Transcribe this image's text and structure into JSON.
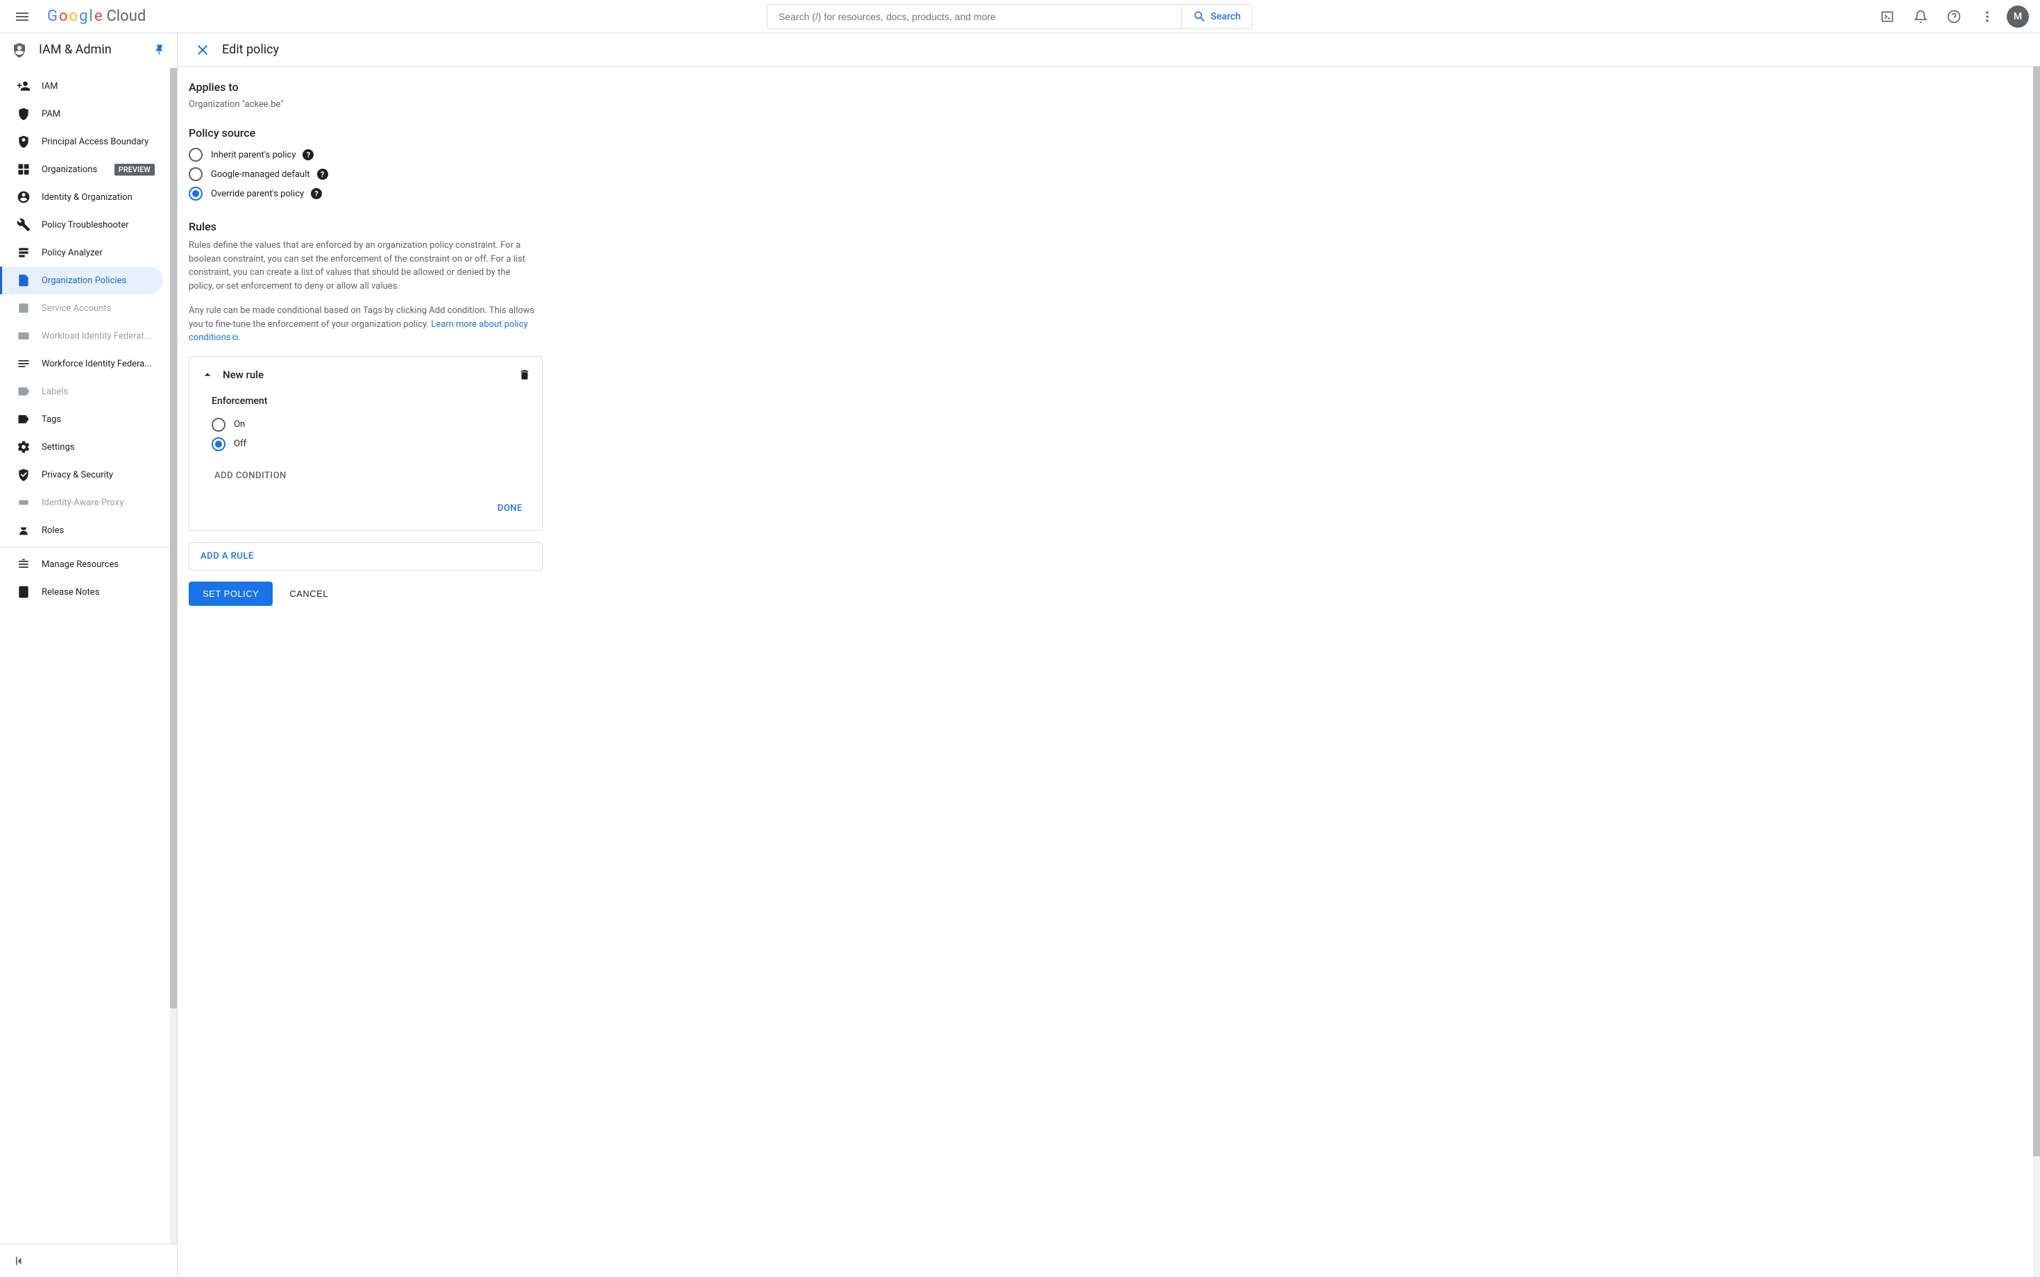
{
  "header": {
    "search_placeholder": "Search (/) for resources, docs, products, and more",
    "search_button": "Search",
    "avatar_letter": "M"
  },
  "sidebar": {
    "title": "IAM & Admin",
    "items": [
      {
        "label": "IAM",
        "icon": "person-add",
        "active": false,
        "disabled": false
      },
      {
        "label": "PAM",
        "icon": "shield",
        "active": false,
        "disabled": false
      },
      {
        "label": "Principal Access Boundary",
        "icon": "boundary",
        "active": false,
        "disabled": false
      },
      {
        "label": "Organizations",
        "icon": "org",
        "active": false,
        "disabled": false,
        "badge": "PREVIEW"
      },
      {
        "label": "Identity & Organization",
        "icon": "account",
        "active": false,
        "disabled": false
      },
      {
        "label": "Policy Troubleshooter",
        "icon": "wrench",
        "active": false,
        "disabled": false
      },
      {
        "label": "Policy Analyzer",
        "icon": "analyzer",
        "active": false,
        "disabled": false
      },
      {
        "label": "Organization Policies",
        "icon": "doc",
        "active": true,
        "disabled": false
      },
      {
        "label": "Service Accounts",
        "icon": "service",
        "active": false,
        "disabled": true
      },
      {
        "label": "Workload Identity Federat...",
        "icon": "workload",
        "active": false,
        "disabled": true
      },
      {
        "label": "Workforce Identity Federa...",
        "icon": "workforce",
        "active": false,
        "disabled": false
      },
      {
        "label": "Labels",
        "icon": "label",
        "active": false,
        "disabled": true
      },
      {
        "label": "Tags",
        "icon": "tag",
        "active": false,
        "disabled": false
      },
      {
        "label": "Settings",
        "icon": "gear",
        "active": false,
        "disabled": false
      },
      {
        "label": "Privacy & Security",
        "icon": "privacy",
        "active": false,
        "disabled": false
      },
      {
        "label": "Identity-Aware Proxy",
        "icon": "proxy",
        "active": false,
        "disabled": true
      },
      {
        "label": "Roles",
        "icon": "roles",
        "active": false,
        "disabled": false
      }
    ],
    "footer_items": [
      {
        "label": "Manage Resources",
        "icon": "manage"
      },
      {
        "label": "Release Notes",
        "icon": "notes"
      }
    ]
  },
  "main": {
    "title": "Edit policy",
    "applies_to_heading": "Applies to",
    "applies_to_value": "Organization \"ackee.be\"",
    "policy_source_heading": "Policy source",
    "policy_source_options": [
      {
        "label": "Inherit parent's policy",
        "selected": false
      },
      {
        "label": "Google-managed default",
        "selected": false
      },
      {
        "label": "Override parent's policy",
        "selected": true
      }
    ],
    "rules_heading": "Rules",
    "rules_desc_1": "Rules define the values that are enforced by an organization policy constraint. For a boolean constraint, you can set the enforcement of the constraint on or off. For a list constraint, you can create a list of values that should be allowed or denied by the policy, or set enforcement to deny or allow all values.",
    "rules_desc_2a": "Any rule can be made conditional based on Tags by clicking Add condition. This allows you to fine-tune the enforcement of your organization policy. ",
    "rules_link": "Learn more about policy conditions",
    "rule_card": {
      "title": "New rule",
      "enforcement_heading": "Enforcement",
      "enforcement_options": [
        {
          "label": "On",
          "selected": false
        },
        {
          "label": "Off",
          "selected": true
        }
      ],
      "add_condition": "ADD CONDITION",
      "done": "DONE"
    },
    "add_rule": "ADD A RULE",
    "set_policy": "SET POLICY",
    "cancel": "CANCEL"
  }
}
